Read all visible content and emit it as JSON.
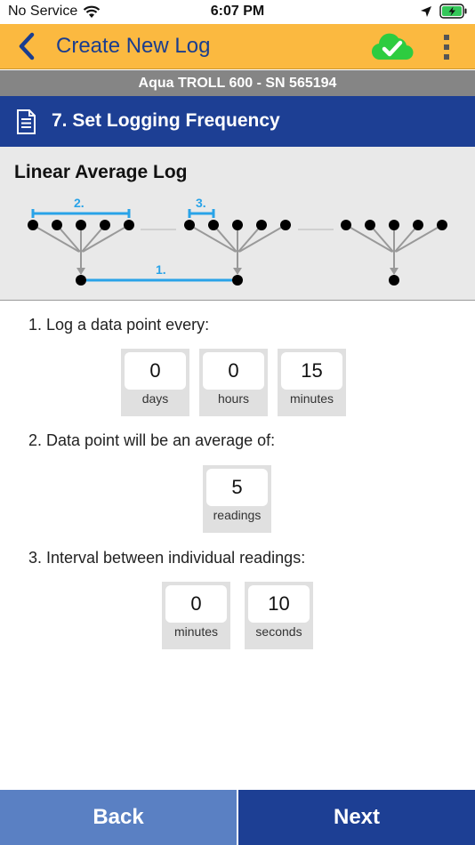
{
  "status_bar": {
    "carrier": "No Service",
    "time": "6:07 PM"
  },
  "app_bar": {
    "title": "Create New Log"
  },
  "device": {
    "label": "Aqua TROLL 600 - SN 565194"
  },
  "step": {
    "title": "7. Set Logging Frequency"
  },
  "diagram": {
    "title": "Linear Average Log",
    "label_1": "1.",
    "label_2": "2.",
    "label_3": "3."
  },
  "questions": {
    "q1": {
      "label": "1. Log a data point every:",
      "fields": [
        {
          "value": "0",
          "unit": "days"
        },
        {
          "value": "0",
          "unit": "hours"
        },
        {
          "value": "15",
          "unit": "minutes"
        }
      ]
    },
    "q2": {
      "label": "2. Data point will be an average of:",
      "fields": [
        {
          "value": "5",
          "unit": "readings"
        }
      ]
    },
    "q3": {
      "label": "3. Interval between individual readings:",
      "fields": [
        {
          "value": "0",
          "unit": "minutes"
        },
        {
          "value": "10",
          "unit": "seconds"
        }
      ]
    }
  },
  "buttons": {
    "back": "Back",
    "next": "Next"
  },
  "colors": {
    "app_bar": "#fbb940",
    "primary": "#1d3f94",
    "secondary": "#5a80c3",
    "accent_blue": "#29a3e8",
    "cloud_green": "#2ecc40"
  }
}
